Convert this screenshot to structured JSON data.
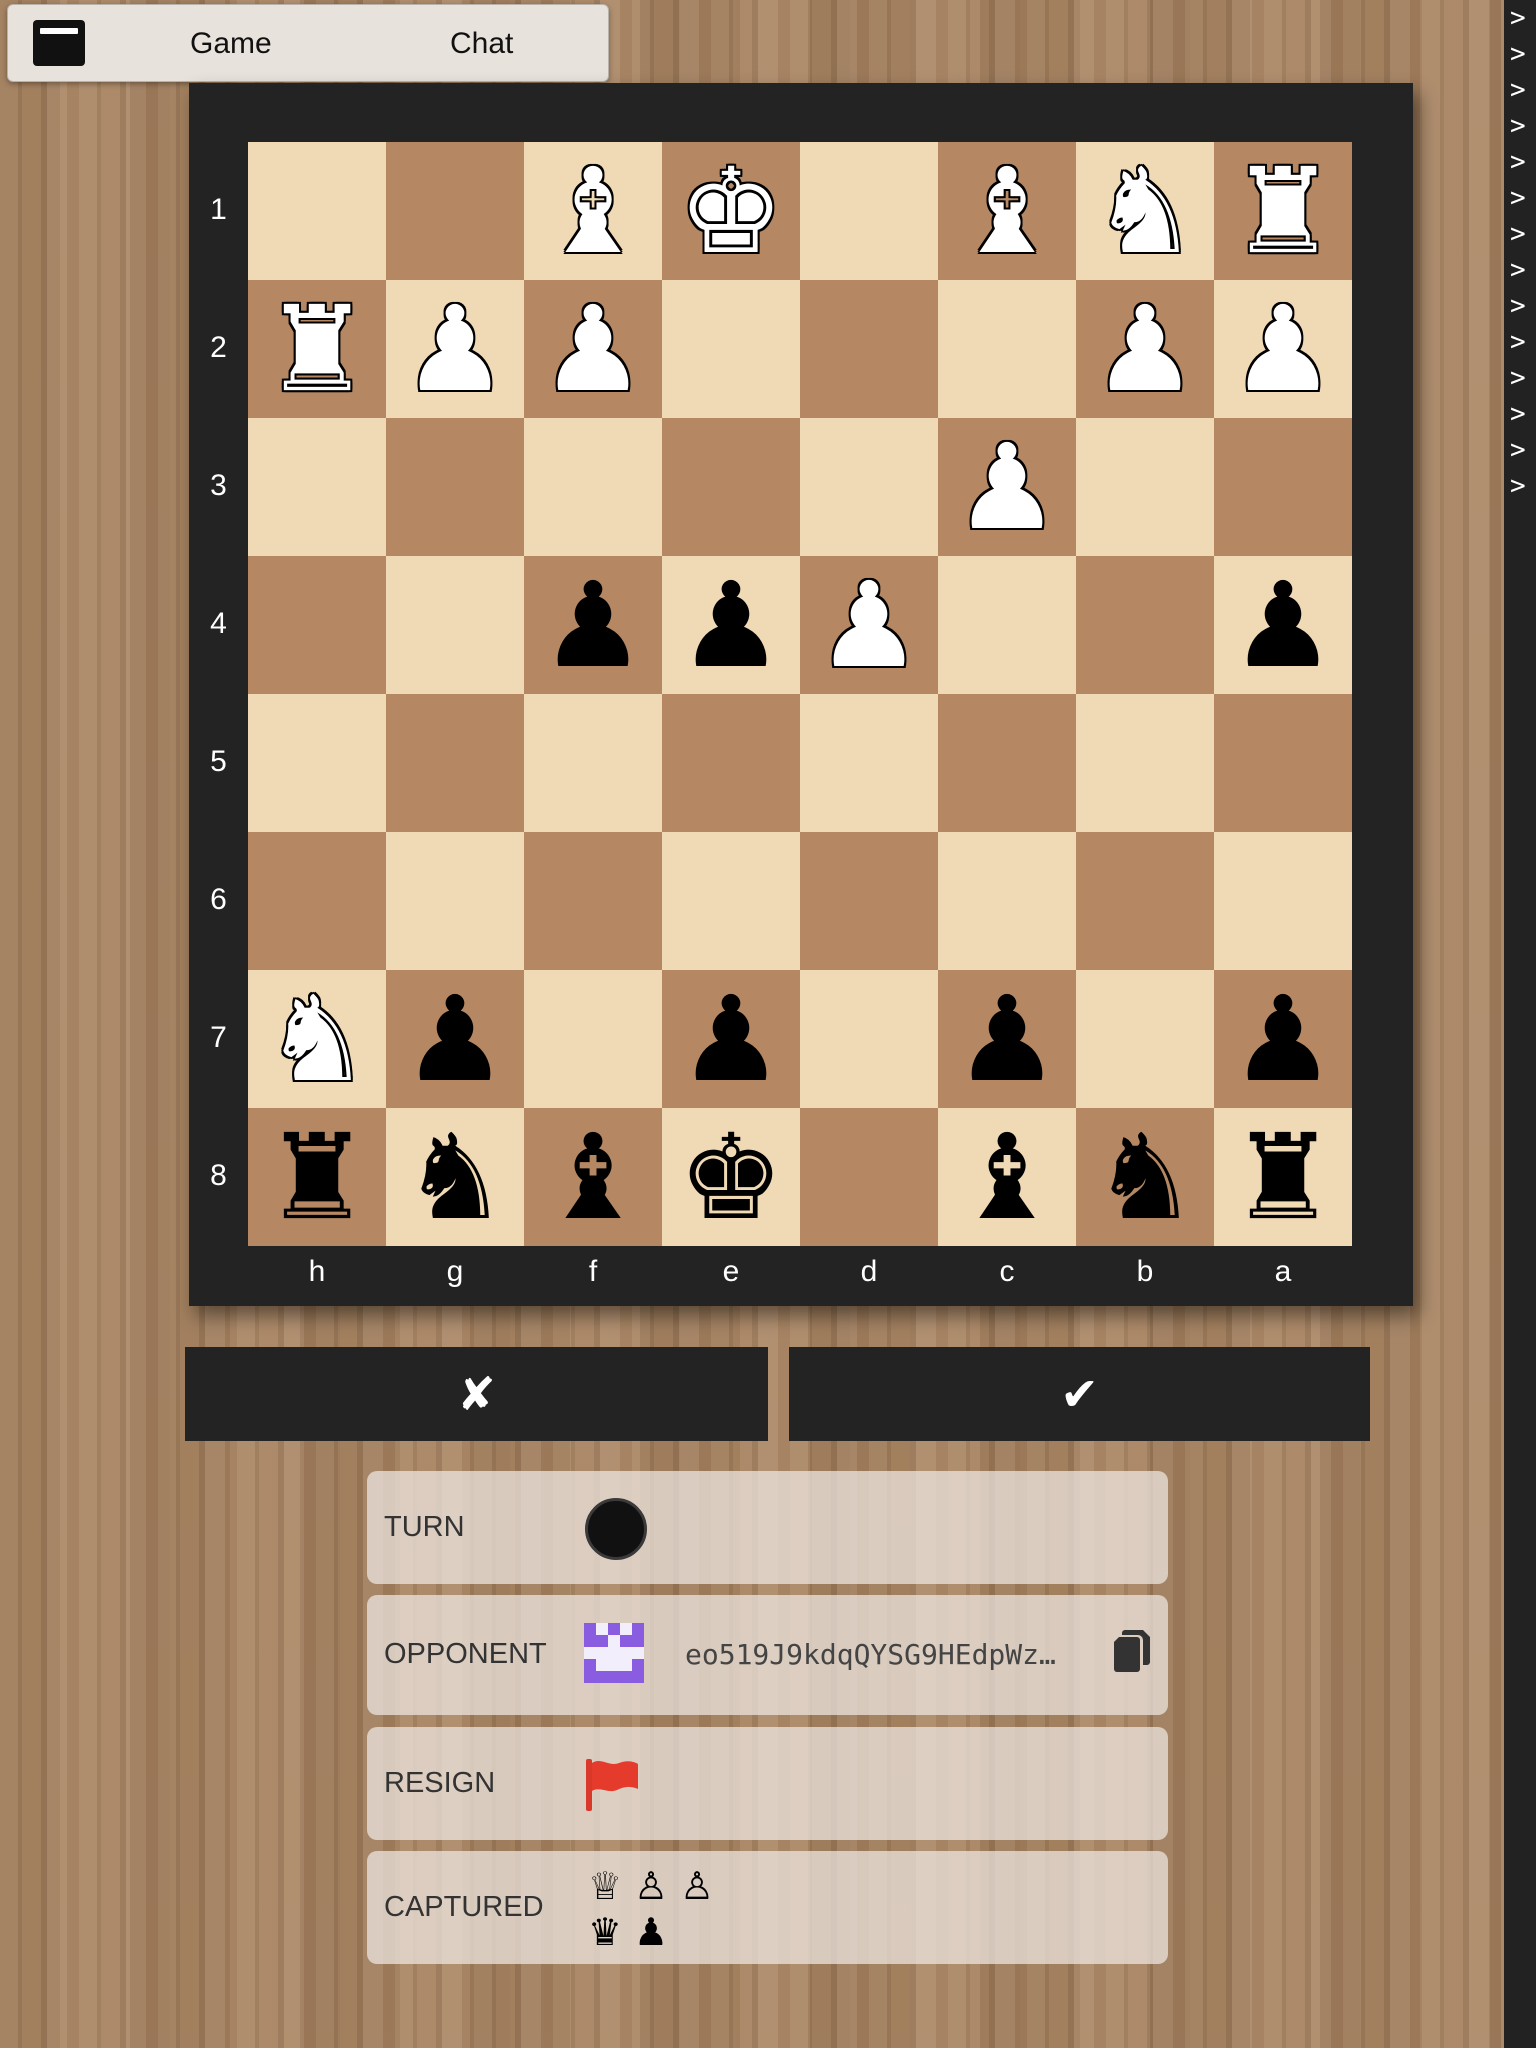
{
  "topbar": {
    "menu_icon": "menu-icon",
    "tabs": [
      "Game",
      "Chat"
    ]
  },
  "side_strip": {
    "glyphs": [
      ">",
      ">",
      ">",
      ">",
      ">",
      ">",
      ">",
      ">",
      ">",
      ">",
      ">",
      ">",
      ">",
      ">"
    ]
  },
  "board": {
    "ranks": [
      "1",
      "2",
      "3",
      "4",
      "5",
      "6",
      "7",
      "8"
    ],
    "files": [
      "h",
      "g",
      "f",
      "e",
      "d",
      "c",
      "b",
      "a"
    ],
    "rows": [
      [
        "",
        "",
        "wB",
        "wK",
        "",
        "wB",
        "wN",
        "wR"
      ],
      [
        "wR",
        "wP",
        "wP",
        "",
        "",
        "",
        "wP",
        "wP"
      ],
      [
        "",
        "",
        "",
        "",
        "",
        "wP",
        "",
        ""
      ],
      [
        "",
        "",
        "bP",
        "bP",
        "wP",
        "",
        "",
        "bP"
      ],
      [
        "",
        "",
        "",
        "",
        "",
        "",
        "",
        ""
      ],
      [
        "",
        "",
        "",
        "",
        "",
        "",
        "",
        ""
      ],
      [
        "wN",
        "bP",
        "",
        "bP",
        "",
        "bP",
        "",
        "bP"
      ],
      [
        "bR",
        "bN",
        "bB",
        "bK",
        "",
        "bB",
        "bN",
        "bR"
      ]
    ],
    "light_color": "#f0d9b5",
    "dark_color": "#b58863"
  },
  "actions": {
    "cancel": "✘",
    "confirm": "✔"
  },
  "info": {
    "turn_label": "TURN",
    "turn_color": "black",
    "opponent_label": "OPPONENT",
    "opponent_id": "eo519J9kdqQYSG9HEdpWz…",
    "opponent_avatar_color": "#8a5ce0",
    "copy_icon": "copy-icon",
    "resign_label": "RESIGN",
    "resign_icon": "flag-icon",
    "resign_color": "#e53b2c",
    "captured_label": "CAPTURED",
    "captured_white": [
      "♕",
      "♙",
      "♙"
    ],
    "captured_black": [
      "♛",
      "♟"
    ]
  }
}
